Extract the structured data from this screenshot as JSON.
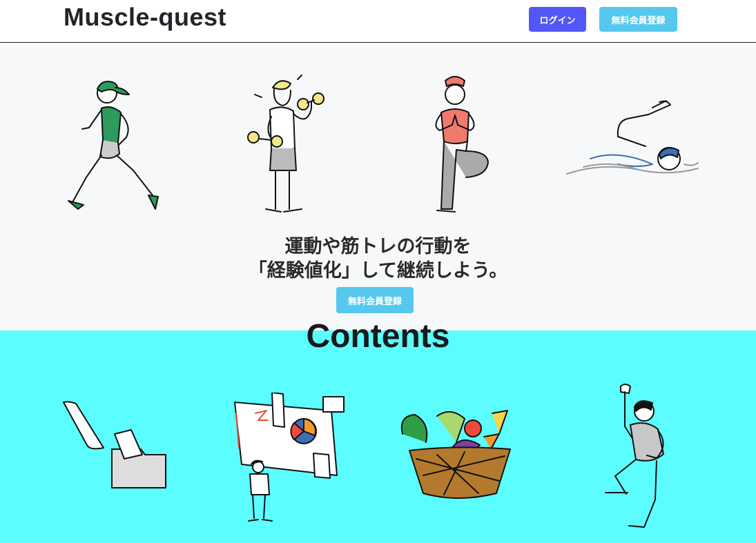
{
  "header": {
    "brand": "Muscle-quest",
    "login_label": "ログイン",
    "signup_label": "無料会員登録"
  },
  "hero": {
    "headline_line1": "運動や筋トレの行動を",
    "headline_line2": "「経験値化」して継続しよう。",
    "signup_label": "無料会員登録",
    "illustrations": [
      "runner-illustration",
      "dumbbell-man-illustration",
      "yoga-woman-illustration",
      "swimmer-illustration"
    ]
  },
  "contents": {
    "title": "Contents",
    "illustrations": [
      "file-folder-illustration",
      "presentation-illustration",
      "vegetable-basket-illustration",
      "cheering-man-illustration"
    ]
  },
  "colors": {
    "login_button": "#5457f7",
    "signup_button": "#56c8ee",
    "hero_background": "#f7f8fa",
    "contents_background": "#5bfdff"
  }
}
